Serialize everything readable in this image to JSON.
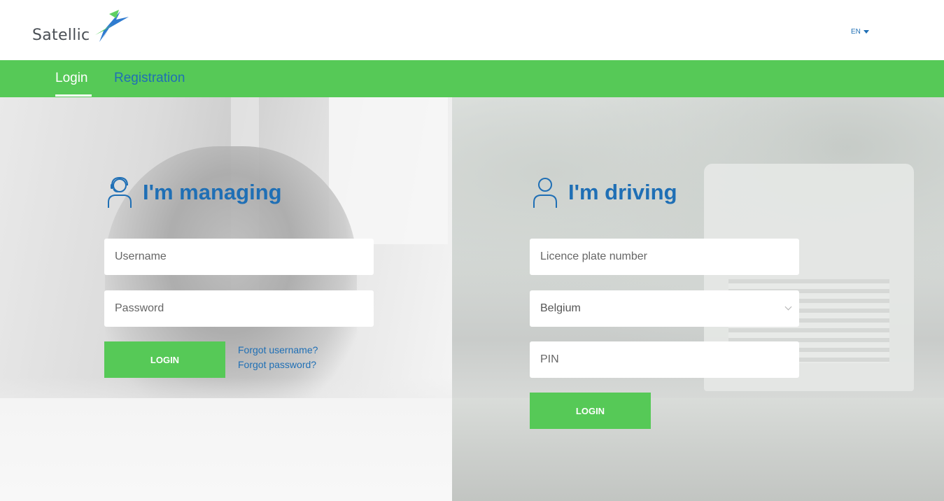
{
  "header": {
    "brand_name": "Satellic",
    "language": "EN",
    "icons": {
      "logo": "satellic-bird-logo",
      "caret": "caret-down-icon"
    }
  },
  "nav": {
    "tabs": [
      {
        "label": "Login",
        "active": true
      },
      {
        "label": "Registration",
        "active": false
      }
    ]
  },
  "managing": {
    "title": "I'm managing",
    "icon": "headset-person-icon",
    "username_placeholder": "Username",
    "password_placeholder": "Password",
    "login_label": "LOGIN",
    "forgot_username": "Forgot username?",
    "forgot_password": "Forgot password?"
  },
  "driving": {
    "title": "I'm driving",
    "icon": "person-icon",
    "licence_placeholder": "Licence plate number",
    "country_value": "Belgium",
    "pin_placeholder": "PIN",
    "login_label": "LOGIN"
  },
  "colors": {
    "brand_green": "#56c957",
    "brand_blue": "#1f6fb5",
    "text_grey": "#4a4f55"
  }
}
